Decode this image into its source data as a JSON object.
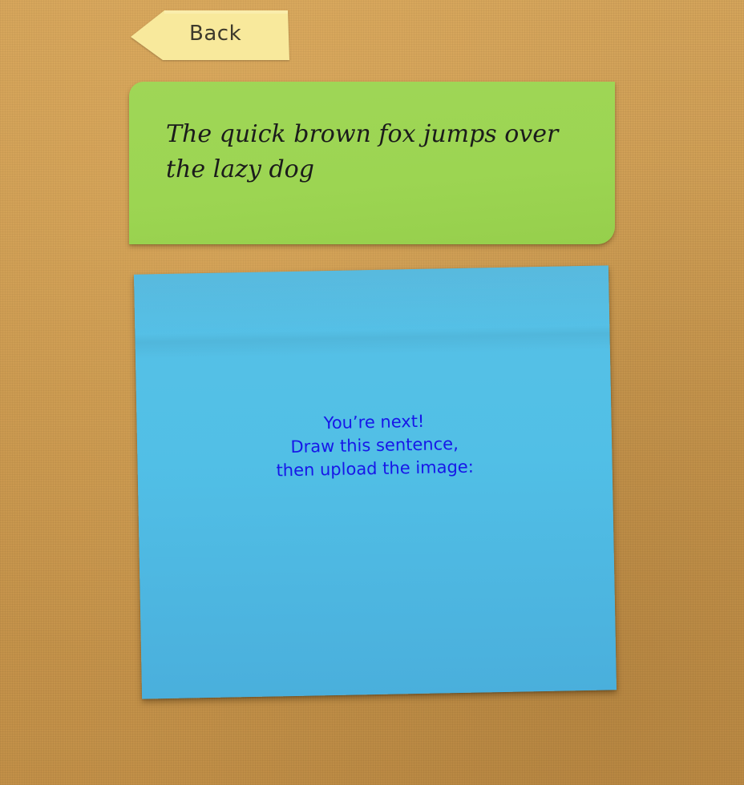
{
  "back_button": {
    "label": "Back"
  },
  "sentence_note": {
    "text": "The quick brown fox jumps over the lazy dog",
    "color": "#9ed556"
  },
  "drawing_note": {
    "lines": [
      "You’re next!",
      "Draw this sentence,",
      "then upload the image:"
    ],
    "color": "#54c0e6",
    "text_color": "#1717e8"
  },
  "background": {
    "color": "#c99a50"
  }
}
